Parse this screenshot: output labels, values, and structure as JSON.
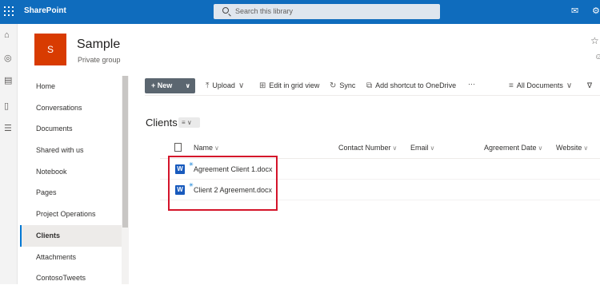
{
  "suite": {
    "brand": "SharePoint"
  },
  "search": {
    "placeholder": "Search this library"
  },
  "site": {
    "logo_letter": "S",
    "title": "Sample",
    "subtitle": "Private group",
    "logo_color": "#d83b01"
  },
  "nav": {
    "items": [
      {
        "label": "Home"
      },
      {
        "label": "Conversations"
      },
      {
        "label": "Documents"
      },
      {
        "label": "Shared with us"
      },
      {
        "label": "Notebook"
      },
      {
        "label": "Pages"
      },
      {
        "label": "Project Operations"
      },
      {
        "label": "Clients",
        "selected": true
      },
      {
        "label": "Attachments"
      },
      {
        "label": "ContosoTweets"
      }
    ]
  },
  "commandbar": {
    "new_label": "New",
    "upload_label": "Upload",
    "grid_label": "Edit in grid view",
    "sync_label": "Sync",
    "shortcut_label": "Add shortcut to OneDrive",
    "more_label": "···",
    "view_label": "All Documents"
  },
  "library": {
    "title": "Clients",
    "columns": {
      "name": "Name",
      "contact": "Contact Number",
      "email": "Email",
      "agreement_date": "Agreement Date",
      "website": "Website"
    },
    "files": [
      {
        "name": "Agreement Client 1.docx"
      },
      {
        "name": "Client 2 Agreement.docx"
      }
    ]
  },
  "colors": {
    "suitebar": "#0f6cbd",
    "accent": "#0078d4",
    "highlight": "#d4142a"
  }
}
